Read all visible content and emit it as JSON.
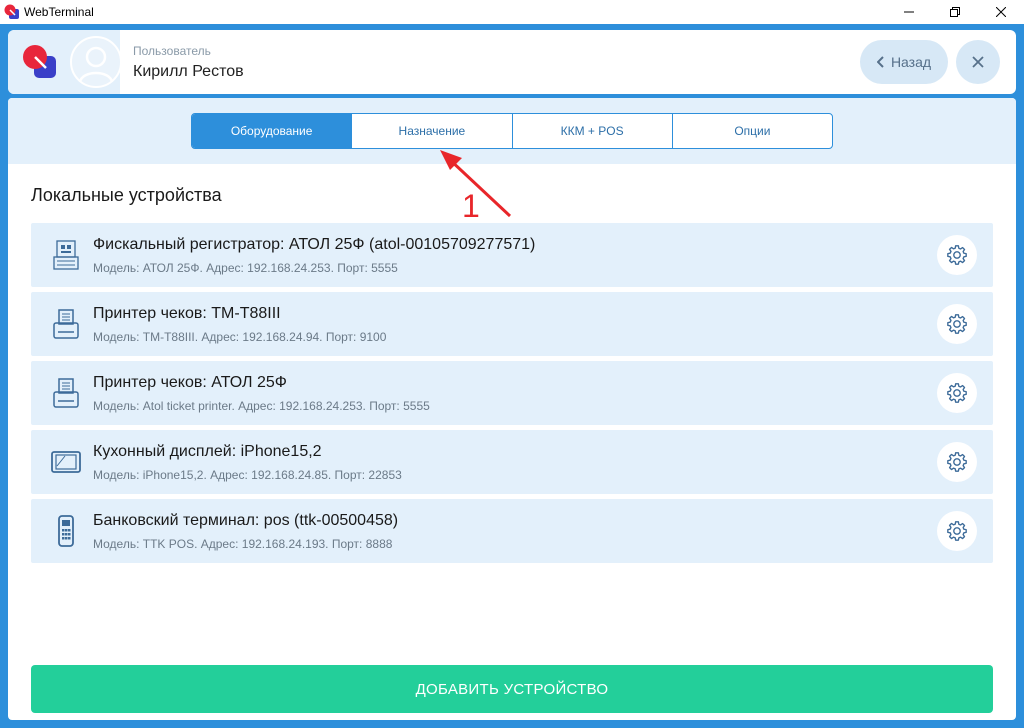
{
  "window": {
    "title": "WebTerminal"
  },
  "header": {
    "user_role": "Пользователь",
    "user_name": "Кирилл Рестов",
    "back_label": "Назад"
  },
  "tabs": [
    {
      "label": "Оборудование",
      "active": true
    },
    {
      "label": "Назначение",
      "active": false
    },
    {
      "label": "ККМ + POS",
      "active": false
    },
    {
      "label": "Опции",
      "active": false
    }
  ],
  "section_title": "Локальные устройства",
  "devices": [
    {
      "name": "Фискальный регистратор: АТОЛ 25Ф (atol-00105709277571)",
      "meta": "Модель: АТОЛ 25Ф. Адрес: 192.168.24.253. Порт: 5555",
      "icon": "fiscal-register-icon"
    },
    {
      "name": "Принтер чеков: TM-T88III",
      "meta": "Модель: TM-T88III. Адрес: 192.168.24.94. Порт: 9100",
      "icon": "receipt-printer-icon"
    },
    {
      "name": "Принтер чеков: АТОЛ 25Ф",
      "meta": "Модель: Atol ticket printer. Адрес: 192.168.24.253. Порт: 5555",
      "icon": "receipt-printer-icon"
    },
    {
      "name": "Кухонный дисплей: iPhone15,2",
      "meta": "Модель: iPhone15,2. Адрес: 192.168.24.85. Порт: 22853",
      "icon": "kitchen-display-icon"
    },
    {
      "name": "Банковский терминал: pos (ttk-00500458)",
      "meta": "Модель: TTK POS. Адрес: 192.168.24.193. Порт: 8888",
      "icon": "bank-terminal-icon"
    }
  ],
  "annotation": {
    "number": "1"
  },
  "add_button_label": "ДОБАВИТЬ УСТРОЙСТВО",
  "colors": {
    "accent": "#2d8fdb",
    "light": "#e3f0fb",
    "add_button": "#23cf9a",
    "annotation": "#e8262a"
  }
}
